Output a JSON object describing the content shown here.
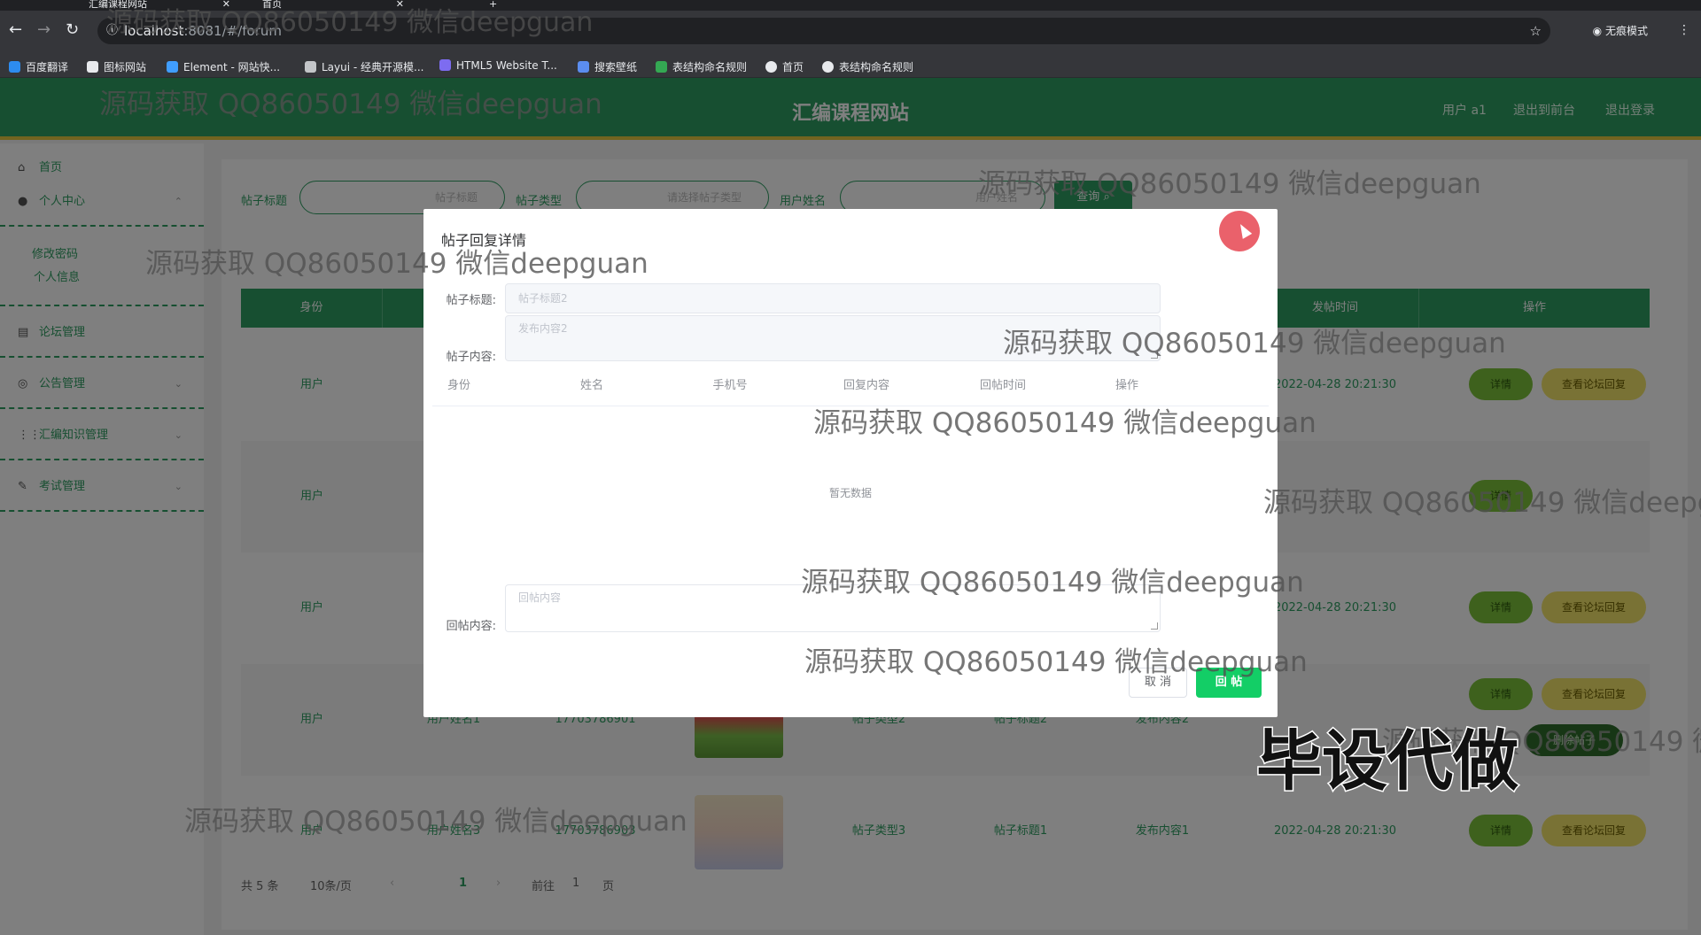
{
  "browser": {
    "tabs": [
      {
        "title": "汇编课程网站"
      },
      {
        "title": "首页"
      }
    ],
    "url_host": "localhost",
    "url_rest": ":8081/#/forum",
    "incognito_label": "无痕模式",
    "bookmarks": [
      "百度翻译",
      "图标网站",
      "Element - 网站快...",
      "Layui - 经典开源模...",
      "HTML5 Website T...",
      "搜索壁纸",
      "表结构命名规则",
      "首页",
      "表结构命名规则"
    ]
  },
  "header": {
    "title": "汇编课程网站",
    "user": "用户 a1",
    "back_to_front": "退出到前台",
    "logout": "退出登录"
  },
  "sidebar": {
    "home": "首页",
    "personal_center": "个人中心",
    "change_password": "修改密码",
    "personal_info": "个人信息",
    "forum_mgmt": "论坛管理",
    "notice_mgmt": "公告管理",
    "knowledge_mgmt": "汇编知识管理",
    "exam_mgmt": "考试管理"
  },
  "search": {
    "title_label": "帖子标题",
    "title_placeholder": "帖子标题",
    "type_label": "帖子类型",
    "type_placeholder": "请选择帖子类型",
    "user_label": "用户姓名",
    "user_placeholder": "用户姓名",
    "button": "查询"
  },
  "table": {
    "headers": {
      "identity": "身份",
      "post_time": "发帖时间",
      "actions": "操作"
    },
    "rows": [
      {
        "identity": "用户",
        "time": "2022-04-28 20:21:30"
      },
      {
        "identity": "用户"
      },
      {
        "identity": "用户",
        "time": "2022-04-28 20:21:30"
      },
      {
        "identity": "用户",
        "name": "用户姓名1",
        "phone": "17703786901",
        "type": "帖子类型2",
        "title": "帖子标题2",
        "content": "发布内容2",
        "action3": "删除帖子"
      },
      {
        "identity": "用户",
        "name": "用户姓名3",
        "phone": "17703786903",
        "type": "帖子类型3",
        "title": "帖子标题1",
        "content": "发布内容1",
        "time": "2022-04-28 20:21:30"
      }
    ],
    "detail_btn": "详情",
    "view_replies_btn": "查看论坛回复"
  },
  "pagination": {
    "total": "共 5 条",
    "page_size": "10条/页",
    "current": "1",
    "goto": "前往",
    "goto_value": "1",
    "page_suffix": "页"
  },
  "dialog": {
    "title": "帖子回复详情",
    "post_title_label": "帖子标题:",
    "post_title_value": "帖子标题2",
    "post_content_label": "帖子内容:",
    "post_content_value": "发布内容2",
    "columns": [
      "身份",
      "姓名",
      "手机号",
      "回复内容",
      "回帖时间",
      "操作"
    ],
    "empty_text": "暂无数据",
    "reply_label": "回帖内容:",
    "reply_placeholder": "回帖内容",
    "cancel": "取 消",
    "submit": "回 帖"
  },
  "watermark": "源码获取 QQ86050149 微信deepguan",
  "stamp": "毕设代做",
  "colors": {
    "primary": "#2f9e62",
    "accent_yellow": "#e5c841",
    "button_green": "#13ce66",
    "close_red": "#e8505b"
  }
}
